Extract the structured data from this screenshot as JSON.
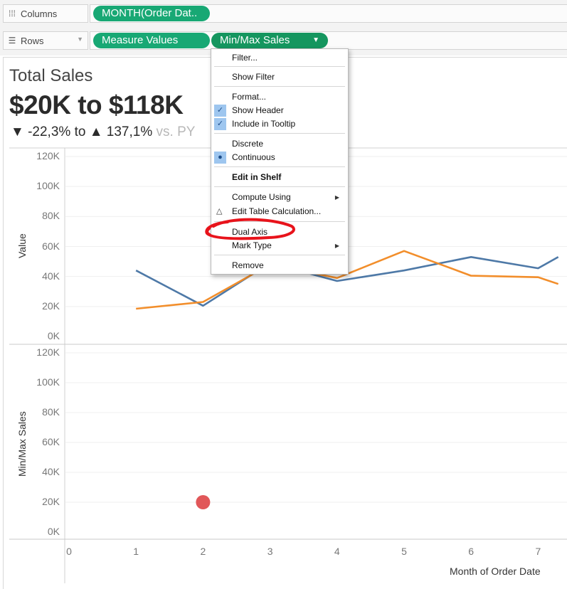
{
  "shelves": {
    "columns": {
      "label": "Columns",
      "icon": "columns-icon",
      "pills": [
        "MONTH(Order Dat.."
      ]
    },
    "rows": {
      "label": "Rows",
      "icon": "rows-icon",
      "pills": [
        "Measure Values",
        "Min/Max Sales"
      ]
    }
  },
  "header": {
    "title": "Total Sales",
    "kpi": "$20K to $118K",
    "change_low": "-22,3% to",
    "change_high": "137,1%",
    "vs": "vs. PY"
  },
  "context_menu": {
    "items": [
      {
        "label": "Filter..."
      },
      {
        "label": "Show Filter"
      },
      {
        "label": "Format..."
      },
      {
        "label": "Show Header",
        "checked": true
      },
      {
        "label": "Include in Tooltip",
        "checked": true
      },
      {
        "label": "Discrete"
      },
      {
        "label": "Continuous",
        "selected": true
      },
      {
        "label": "Edit in Shelf",
        "bold": true
      },
      {
        "label": "Compute Using",
        "submenu": true
      },
      {
        "label": "Edit Table Calculation...",
        "delta": true
      },
      {
        "label": "Dual Axis",
        "highlighted": true
      },
      {
        "label": "Mark Type",
        "submenu": true
      },
      {
        "label": "Remove"
      }
    ]
  },
  "annotation_color": "#e8131b",
  "chart_data": [
    {
      "type": "line",
      "ylabel": "Value",
      "xlabel": "Month of Order Date",
      "x_ticks": [
        "0",
        "1",
        "2",
        "3",
        "4",
        "5",
        "6",
        "7"
      ],
      "y_ticks": [
        "0K",
        "20K",
        "40K",
        "60K",
        "80K",
        "100K",
        "120K"
      ],
      "ylim": [
        0,
        125000
      ],
      "xlim": [
        0,
        7.3
      ],
      "grid": true,
      "series": [
        {
          "color": "#4e79a7",
          "x": [
            1,
            2,
            3,
            4,
            5,
            6,
            7,
            7.3
          ],
          "values": [
            44000,
            20500,
            49000,
            37000,
            44000,
            53000,
            45500,
            53000
          ]
        },
        {
          "color": "#f28e2b",
          "x": [
            1,
            2,
            3,
            4,
            5,
            6,
            7,
            7.3
          ],
          "values": [
            18500,
            23000,
            48000,
            39000,
            57000,
            40500,
            39500,
            35000
          ]
        }
      ]
    },
    {
      "type": "scatter",
      "ylabel": "Min/Max Sales",
      "xlabel": "Month of Order Date",
      "x_ticks": [
        "0",
        "1",
        "2",
        "3",
        "4",
        "5",
        "6",
        "7"
      ],
      "y_ticks": [
        "0K",
        "20K",
        "40K",
        "60K",
        "80K",
        "100K",
        "120K"
      ],
      "ylim": [
        0,
        125000
      ],
      "grid": true,
      "series": [
        {
          "color": "#e15759",
          "x": [
            2
          ],
          "values": [
            20000
          ]
        }
      ]
    }
  ]
}
